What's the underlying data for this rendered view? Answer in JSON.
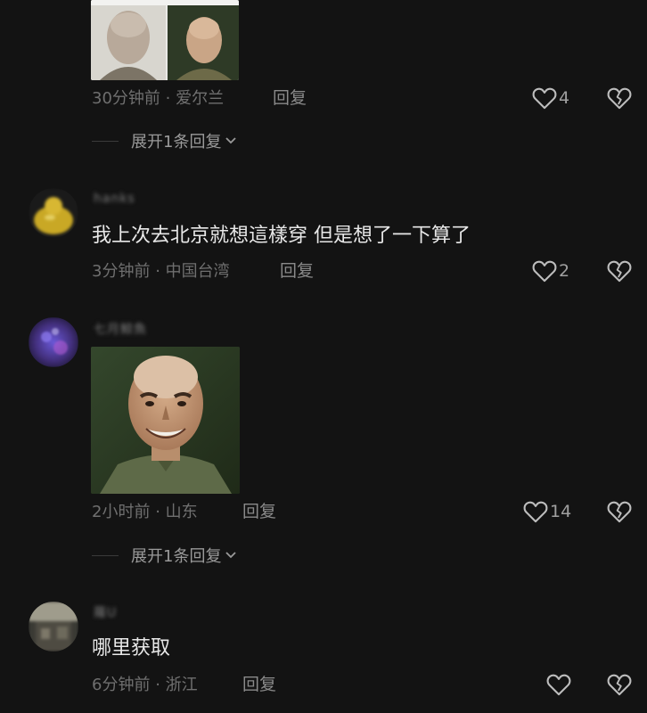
{
  "comments": [
    {
      "meta_time": "30分钟前",
      "meta_location": "爱尔兰",
      "reply_label": "回复",
      "likes": "4",
      "expand_label": "展开1条回复"
    },
    {
      "username": "hanks",
      "text": "我上次去北京就想這樣穿 但是想了一下算了",
      "meta_time": "3分钟前",
      "meta_location": "中国台湾",
      "reply_label": "回复",
      "likes": "2"
    },
    {
      "username": "七月鯨魚",
      "meta_time": "2小时前",
      "meta_location": "山东",
      "reply_label": "回复",
      "likes": "14",
      "expand_label": "展开1条回复"
    },
    {
      "username": "羅U",
      "text": "哪里获取",
      "meta_time": "6分钟前",
      "meta_location": "浙江",
      "reply_label": "回复",
      "likes": ""
    }
  ],
  "separator": "·",
  "icons": {
    "like": "heart-outline-icon",
    "dislike": "broken-heart-icon",
    "expand": "chevron-down-icon"
  },
  "colors": {
    "background": "#131313",
    "text": "#e8e8e8",
    "meta": "#6f6f6f"
  }
}
